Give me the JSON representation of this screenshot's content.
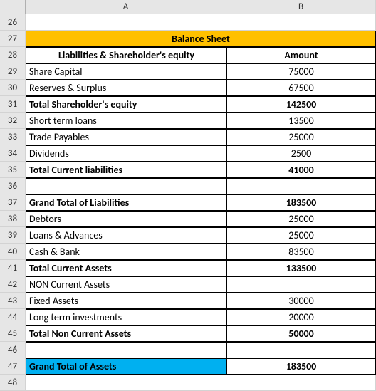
{
  "columns": {
    "a": "A",
    "b": "B"
  },
  "rows": [
    "26",
    "27",
    "28",
    "29",
    "30",
    "31",
    "32",
    "33",
    "34",
    "35",
    "36",
    "37",
    "38",
    "39",
    "40",
    "41",
    "42",
    "43",
    "44",
    "45",
    "46",
    "47",
    "48"
  ],
  "title": "Balance Sheet",
  "header": {
    "label": "Liabilities & Shareholder's equity",
    "amount": "Amount"
  },
  "lines": {
    "share_capital": {
      "label": "Share Capital",
      "amount": "75000"
    },
    "reserves": {
      "label": "Reserves & Surplus",
      "amount": "67500"
    },
    "total_equity": {
      "label": "Total Shareholder's equity",
      "amount": "142500"
    },
    "st_loans": {
      "label": "Short term loans",
      "amount": "13500"
    },
    "trade_payables": {
      "label": "Trade Payables",
      "amount": "25000"
    },
    "dividends": {
      "label": "Dividends",
      "amount": "2500"
    },
    "total_cur_liab": {
      "label": "Total Current liabilities",
      "amount": "41000"
    },
    "grand_liab": {
      "label": "Grand Total of Liabilities",
      "amount": "183500"
    },
    "debtors": {
      "label": "Debtors",
      "amount": "25000"
    },
    "loans_adv": {
      "label": "Loans & Advances",
      "amount": "25000"
    },
    "cash_bank": {
      "label": "Cash & Bank",
      "amount": "83500"
    },
    "total_cur_assets": {
      "label": "Total Current Assets",
      "amount": "133500"
    },
    "non_cur_label": {
      "label": "NON Current Assets",
      "amount": ""
    },
    "fixed_assets": {
      "label": "Fixed Assets",
      "amount": "30000"
    },
    "lt_investments": {
      "label": "Long term investments",
      "amount": "20000"
    },
    "total_noncur_assets": {
      "label": "Total Non Current Assets",
      "amount": "50000"
    },
    "grand_assets": {
      "label": "Grand Total of Assets",
      "amount": "183500"
    }
  }
}
